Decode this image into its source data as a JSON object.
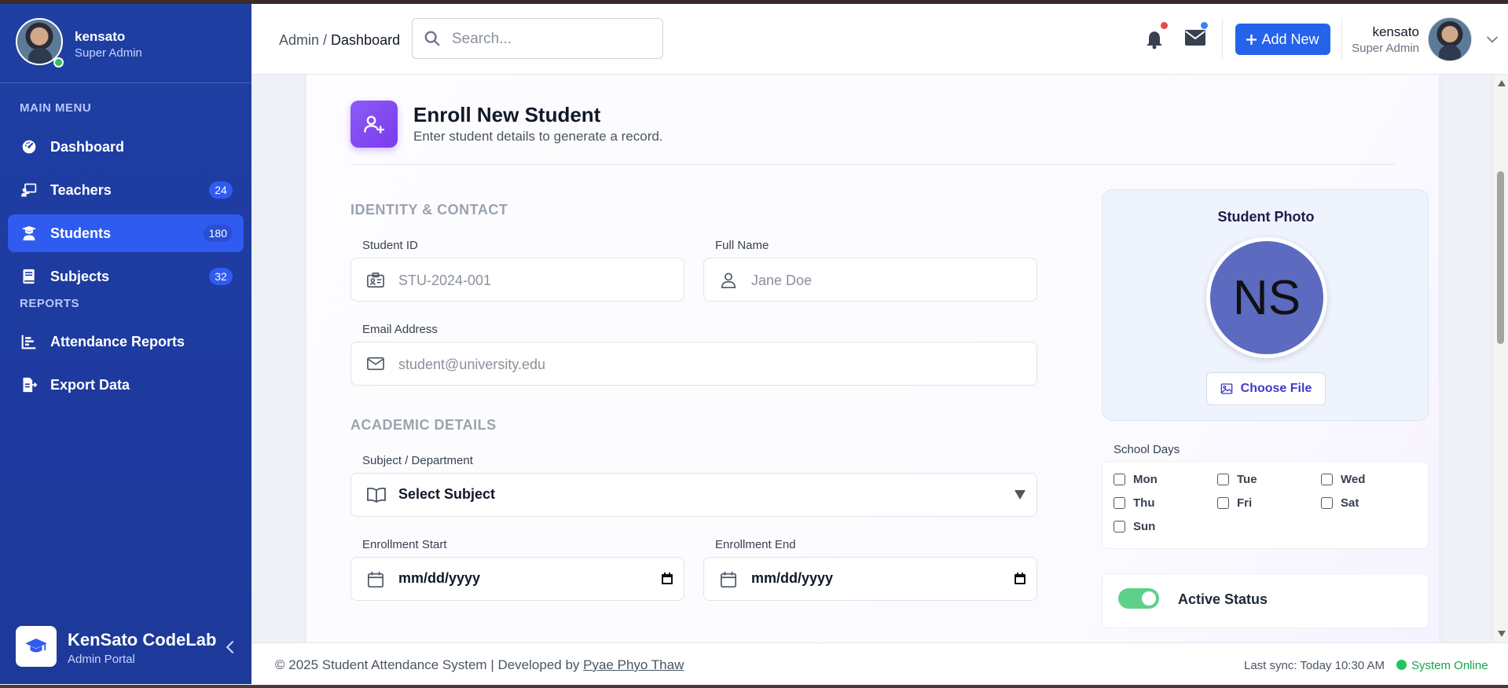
{
  "sidebar": {
    "user": {
      "name": "kensato",
      "role": "Super Admin"
    },
    "main_menu_title": "MAIN MENU",
    "items": [
      {
        "label": "Dashboard",
        "icon": "gauge-icon",
        "badge": ""
      },
      {
        "label": "Teachers",
        "icon": "chalkboard-teacher-icon",
        "badge": "24"
      },
      {
        "label": "Students",
        "icon": "student-icon",
        "badge": "180",
        "active": true
      },
      {
        "label": "Subjects",
        "icon": "book-icon",
        "badge": "32"
      }
    ],
    "reports_title": "REPORTS",
    "report_items": [
      {
        "label": "Attendance Reports",
        "icon": "chart-bars-icon"
      },
      {
        "label": "Export Data",
        "icon": "file-export-icon"
      }
    ],
    "brand": {
      "name": "KenSato CodeLab",
      "subtitle": "Admin Portal"
    }
  },
  "topbar": {
    "breadcrumb": {
      "root": "Admin",
      "sep": " / ",
      "current": "Dashboard"
    },
    "search_placeholder": "Search...",
    "add_new_label": "Add New",
    "user": {
      "name": "kensato",
      "role": "Super Admin"
    }
  },
  "form": {
    "title": "Enroll New Student",
    "subtitle": "Enter student details to generate a record.",
    "identity_section": "IDENTITY & CONTACT",
    "student_id": {
      "label": "Student ID",
      "placeholder": "STU-2024-001"
    },
    "full_name": {
      "label": "Full Name",
      "placeholder": "Jane Doe"
    },
    "email": {
      "label": "Email Address",
      "placeholder": "student@university.edu"
    },
    "academic_section": "ACADEMIC DETAILS",
    "subject": {
      "label": "Subject / Department",
      "value": "Select Subject"
    },
    "enroll_start": {
      "label": "Enrollment Start",
      "value": "mm/dd/yyyy"
    },
    "enroll_end": {
      "label": "Enrollment End",
      "value": "mm/dd/yyyy"
    },
    "photo": {
      "title": "Student Photo",
      "initials": "NS",
      "button": "Choose File"
    },
    "school_days": {
      "label": "School Days",
      "days": [
        "Mon",
        "Tue",
        "Wed",
        "Thu",
        "Fri",
        "Sat",
        "Sun"
      ]
    },
    "active_status": {
      "label": "Active Status",
      "on": true
    }
  },
  "footer": {
    "copyright": "© 2025 Student Attendance System | Developed by ",
    "developer": "Pyae Phyo Thaw",
    "last_sync": "Last sync: Today 10:30 AM",
    "status": "System Online"
  },
  "colors": {
    "sidebar_bg": "#1f3fa3",
    "active_item": "#2f5bf0",
    "primary_button": "#2563eb",
    "header_icon": "#7c3aed",
    "avatar_bg": "#5c6bc0",
    "online": "#22c55e",
    "toggle_on": "#5fd08a"
  }
}
